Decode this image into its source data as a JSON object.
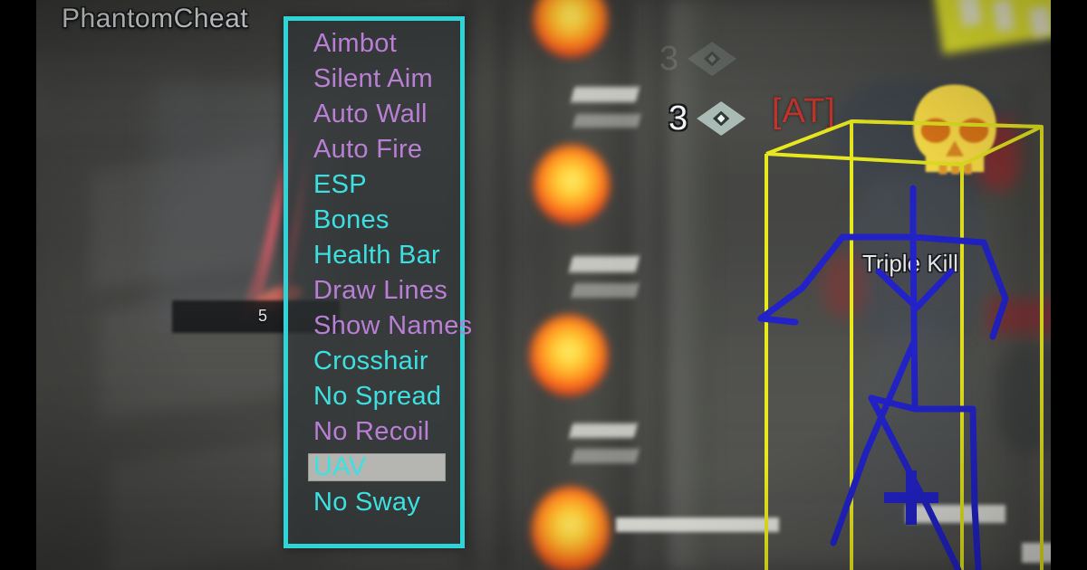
{
  "overlay": {
    "brand_title": "PhantomCheat",
    "accent_color": "#2ed4d8",
    "panel_background": "rgba(46,52,54,0.62)"
  },
  "menu": {
    "selected_item": "UAV",
    "items": [
      {
        "label": "Aimbot",
        "color": "purple",
        "selected": false
      },
      {
        "label": "Silent Aim",
        "color": "purple",
        "selected": false
      },
      {
        "label": "Auto Wall",
        "color": "purple",
        "selected": false
      },
      {
        "label": "Auto Fire",
        "color": "purple",
        "selected": false
      },
      {
        "label": "ESP",
        "color": "cyan",
        "selected": false
      },
      {
        "label": "Bones",
        "color": "cyan",
        "selected": false
      },
      {
        "label": "Health Bar",
        "color": "cyan",
        "selected": false
      },
      {
        "label": "Draw Lines",
        "color": "purple",
        "selected": false
      },
      {
        "label": "Show Names",
        "color": "purple",
        "selected": false
      },
      {
        "label": "Crosshair",
        "color": "cyan",
        "selected": false
      },
      {
        "label": "No Spread",
        "color": "cyan",
        "selected": false
      },
      {
        "label": "No Recoil",
        "color": "purple",
        "selected": false
      },
      {
        "label": "UAV",
        "color": "cyan",
        "selected": true
      },
      {
        "label": "No Sway",
        "color": "cyan",
        "selected": false
      }
    ],
    "colors": {
      "purple": "#b97fd4",
      "cyan": "#3ce0e0",
      "border": "#2ed4d8",
      "highlight": "rgba(213,213,208,0.80)"
    }
  },
  "game_hud": {
    "killstreak_count": "3",
    "killstreak_count_faded": "3",
    "killstreak_icon": "diamond-killstreak-icon",
    "enemy_tag": "[AT]",
    "enemy_tag_color": "#c2342c",
    "medal_text": "Triple Kill",
    "ammo_count": "5",
    "emblem_icon": "skull-emblem-icon"
  },
  "esp": {
    "box_color": "#e8e820",
    "skeleton_color": "#2222c8",
    "bone_marker_icon": "cross-bone-marker-icon",
    "box_label": "enemy-esp-box",
    "skeleton_label": "enemy-skeleton-bones"
  },
  "scene": {
    "lamp_color": "#ffd33b",
    "sign_color": "#e9ea2f",
    "letterbox_color": "#000000"
  }
}
